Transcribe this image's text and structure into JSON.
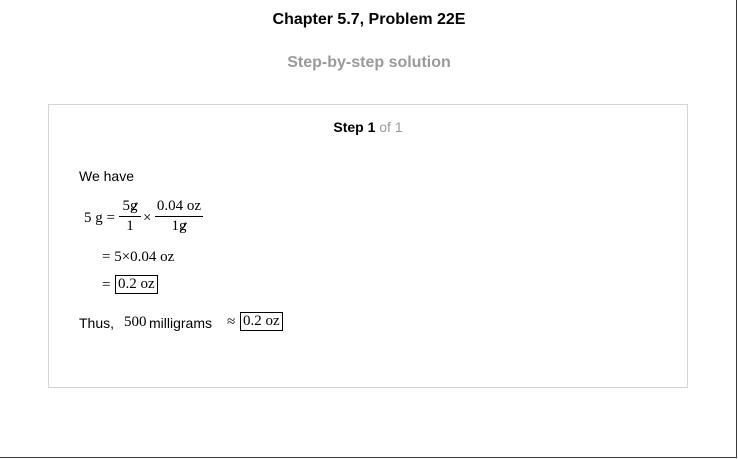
{
  "header": {
    "chapter_title": "Chapter 5.7, Problem 22E",
    "subtitle": "Step-by-step solution"
  },
  "step": {
    "label": "Step 1",
    "of_text": "of 1"
  },
  "solution": {
    "intro": "We have",
    "line1": {
      "lhs": "5 g =",
      "frac1_num_value": "5",
      "frac1_num_unit": "g",
      "frac1_den": "1",
      "times": "×",
      "frac2_num": "0.04 oz",
      "frac2_den_value": "1",
      "frac2_den_unit": "g"
    },
    "line2": "= 5×0.04 oz",
    "line3_eq": "=",
    "line3_result": "0.2 oz",
    "conclusion": {
      "thus": "Thus,",
      "value": "500",
      "unit": "milligrams",
      "approx": "≈",
      "result": "0.2 oz"
    }
  }
}
